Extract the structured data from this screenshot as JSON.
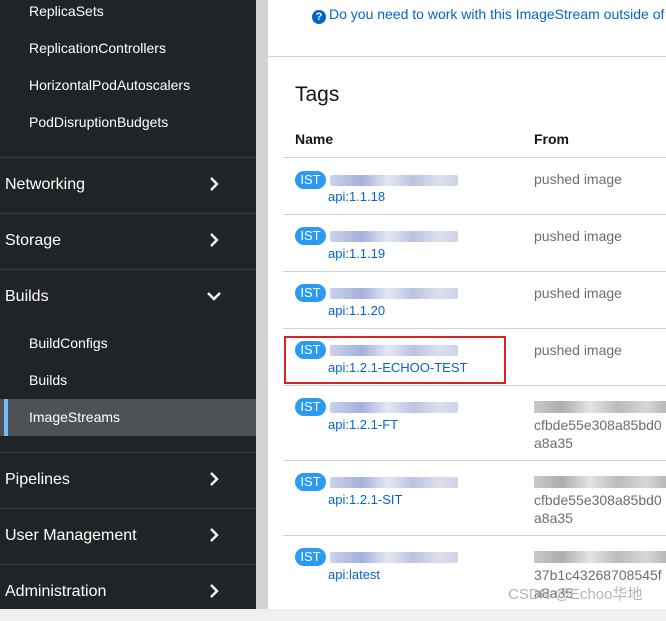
{
  "sidebar": {
    "workloads_items": [
      {
        "label": "ReplicaSets"
      },
      {
        "label": "ReplicationControllers"
      },
      {
        "label": "HorizontalPodAutoscalers"
      },
      {
        "label": "PodDisruptionBudgets"
      }
    ],
    "sections": [
      {
        "label": "Networking",
        "icon": "chevron-right-icon"
      },
      {
        "label": "Storage",
        "icon": "chevron-right-icon"
      },
      {
        "label": "Builds",
        "icon": "chevron-down-icon"
      }
    ],
    "builds_items": [
      {
        "label": "BuildConfigs"
      },
      {
        "label": "Builds"
      },
      {
        "label": "ImageStreams",
        "active": true
      }
    ],
    "sections_after": [
      {
        "label": "Pipelines",
        "icon": "chevron-right-icon"
      },
      {
        "label": "User Management",
        "icon": "chevron-right-icon"
      },
      {
        "label": "Administration",
        "icon": "chevron-right-icon"
      }
    ]
  },
  "banner": {
    "text": "Do you need to work with this ImageStream outside of"
  },
  "tags_section": {
    "title": "Tags",
    "columns": {
      "name": "Name",
      "from": "From"
    },
    "rows": [
      {
        "badge": "IST",
        "tag": "api:1.1.18",
        "from": "pushed image"
      },
      {
        "badge": "IST",
        "tag": "api:1.1.19",
        "from": "pushed image"
      },
      {
        "badge": "IST",
        "tag": "api:1.1.20",
        "from": "pushed image"
      },
      {
        "badge": "IST",
        "tag": "api:1.2.1-ECHOO-TEST",
        "from": "pushed image"
      },
      {
        "badge": "IST",
        "tag": "api:1.2.1-FT",
        "from_line1": "cfbde55e308a85bd0",
        "from_line2": "a8a35"
      },
      {
        "badge": "IST",
        "tag": "api:1.2.1-SIT",
        "from_line1": "cfbde55e308a85bd0",
        "from_line2": "a8a35"
      },
      {
        "badge": "IST",
        "tag": "api:latest",
        "from_line1": "37b1c43268708545f",
        "from_line2": "a8a35"
      }
    ]
  },
  "watermark": "CSDN @Echoo华地",
  "colors": {
    "sidebar_bg": "#212427",
    "link": "#0066cc",
    "badge": "#2b9af3",
    "highlight": "#d82323"
  }
}
